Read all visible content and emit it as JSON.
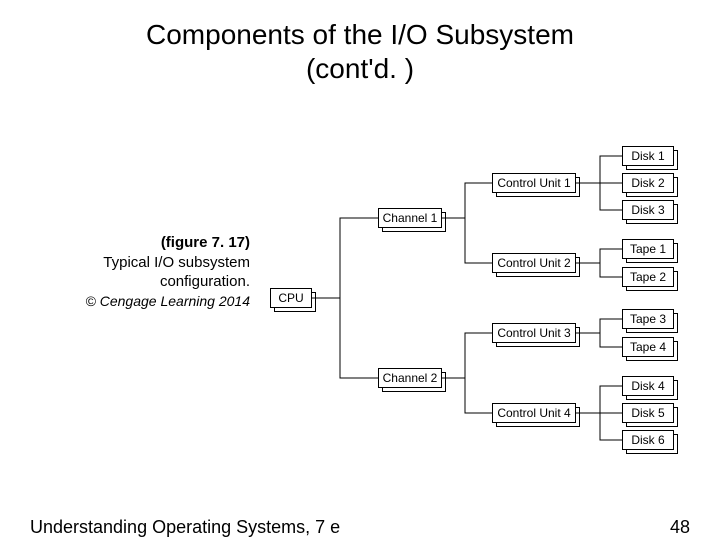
{
  "title_line1": "Components of the I/O Subsystem",
  "title_line2": "(cont'd. )",
  "caption": {
    "figure": "(figure 7. 17)",
    "desc1": "Typical I/O subsystem",
    "desc2": "configuration.",
    "copyright": "© Cengage Learning 2014"
  },
  "footer": {
    "left": "Understanding Operating Systems, 7 e",
    "right": "48"
  },
  "diagram": {
    "cpu": "CPU",
    "channels": [
      "Channel 1",
      "Channel 2"
    ],
    "control_units": [
      "Control Unit 1",
      "Control Unit 2",
      "Control Unit 3",
      "Control Unit 4"
    ],
    "devices": [
      [
        "Disk 1",
        "Disk 2",
        "Disk 3"
      ],
      [
        "Tape 1",
        "Tape 2"
      ],
      [
        "Tape 3",
        "Tape 4"
      ],
      [
        "Disk 4",
        "Disk 5",
        "Disk 6"
      ]
    ]
  }
}
